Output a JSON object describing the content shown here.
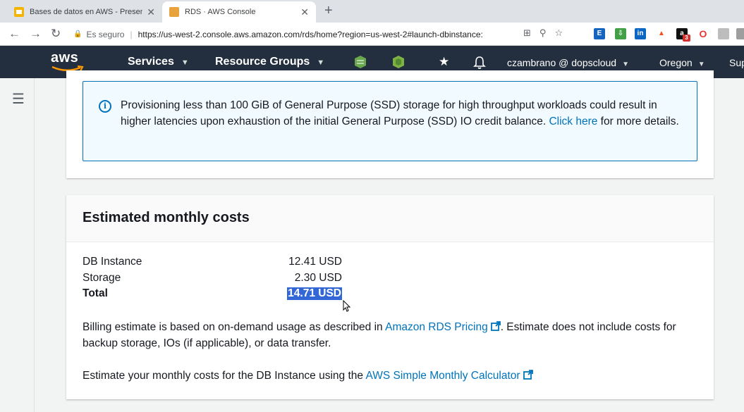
{
  "browser": {
    "tabs": [
      {
        "title": "Bases de datos en AWS - Present",
        "active": false
      },
      {
        "title": "RDS · AWS Console",
        "active": true
      }
    ],
    "security_label": "Es seguro",
    "url": "https://us-west-2.console.aws.amazon.com/rds/home?region=us-west-2#launch-dbinstance:",
    "extension_badge": "3"
  },
  "aws_nav": {
    "logo_text": "aws",
    "services_label": "Services",
    "resource_groups_label": "Resource Groups",
    "user_label": "czambrano @ dopscloud",
    "region_label": "Oregon",
    "support_label": "Sup"
  },
  "info_alert": {
    "text_before_link": "Provisioning less than 100 GiB of General Purpose (SSD) storage for high throughput workloads could result in higher latencies upon exhaustion of the initial General Purpose (SSD) IO credit balance.",
    "link_text": "Click here",
    "text_after_link": "for more details."
  },
  "costs": {
    "title": "Estimated monthly costs",
    "rows": [
      {
        "label": "DB Instance",
        "value": "12.41 USD"
      },
      {
        "label": "Storage",
        "value": "2.30 USD"
      },
      {
        "label": "Total",
        "value": "14.71 USD"
      }
    ],
    "billing_text_before": "Billing estimate is based on on-demand usage as described in",
    "billing_link": "Amazon RDS Pricing",
    "billing_text_after": ". Estimate does not include costs for backup storage, IOs (if applicable), or data transfer.",
    "calc_text": "Estimate your monthly costs for the DB Instance using the",
    "calc_link": "AWS Simple Monthly Calculator"
  },
  "colors": {
    "aws_nav_bg": "#232f3e",
    "link": "#0073bb",
    "info_bg": "#f1faff",
    "selection": "#3367d6"
  }
}
